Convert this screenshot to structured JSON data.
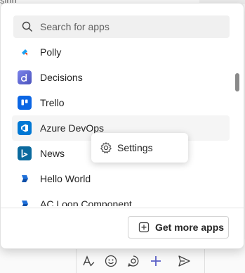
{
  "background": {
    "text": "sinn"
  },
  "search": {
    "placeholder": "Search for apps",
    "value": ""
  },
  "apps": [
    {
      "name": "Polly",
      "icon": "polly-icon",
      "color": "#ffffff"
    },
    {
      "name": "Decisions",
      "icon": "decisions-icon",
      "color": "#5b5fc7"
    },
    {
      "name": "Trello",
      "icon": "trello-icon",
      "color": "#0c66e4"
    },
    {
      "name": "Azure DevOps",
      "icon": "azure-devops-icon",
      "color": "#0078d4"
    },
    {
      "name": "News",
      "icon": "news-icon",
      "color": "#0b6a9e"
    },
    {
      "name": "Hello World",
      "icon": "hello-world-icon",
      "color": "#1e6fd9"
    },
    {
      "name": "AC Loop Component",
      "icon": "ac-loop-icon",
      "color": "#1e6fd9"
    }
  ],
  "context_menu": {
    "label": "Settings"
  },
  "footer": {
    "get_more_label": "Get more apps"
  }
}
